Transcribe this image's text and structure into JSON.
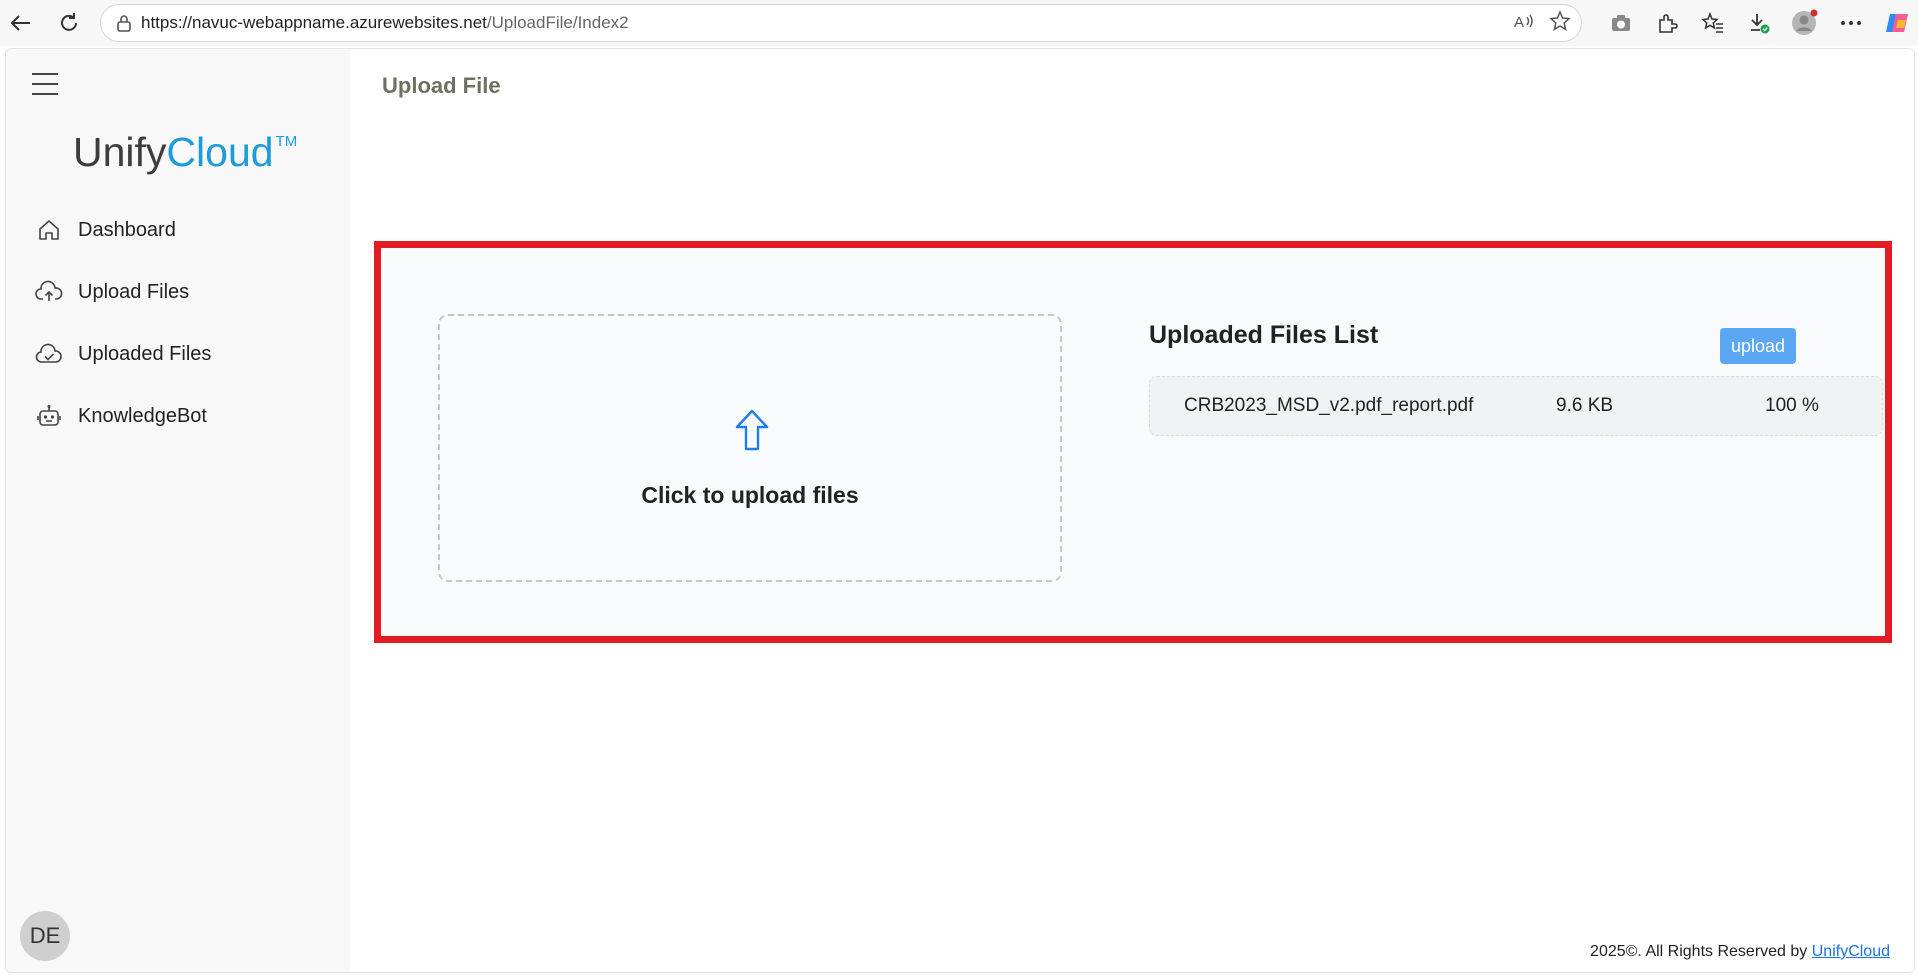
{
  "browser": {
    "url_host": "https://navuc-webappname.azurewebsites.net",
    "url_path": "/UploadFile/Index2",
    "icons": [
      "back-icon",
      "refresh-icon",
      "lock-icon",
      "read-aloud-icon",
      "favorite-star-icon",
      "screenshot-icon",
      "extensions-icon",
      "favorites-icon",
      "downloads-icon",
      "profile-icon",
      "more-icon",
      "copilot-icon"
    ]
  },
  "sidebar": {
    "brand_part1": "Unify",
    "brand_part2": "Cloud",
    "brand_tm": "TM",
    "items": [
      {
        "label": "Dashboard",
        "icon": "home-icon"
      },
      {
        "label": "Upload Files",
        "icon": "cloud-upload-icon"
      },
      {
        "label": "Uploaded Files",
        "icon": "cloud-check-icon"
      },
      {
        "label": "KnowledgeBot",
        "icon": "robot-icon"
      }
    ],
    "avatar_initials": "DE"
  },
  "main": {
    "page_title": "Upload File",
    "dropzone_text": "Click to upload files",
    "list_title": "Uploaded Files List",
    "upload_button": "upload",
    "files": [
      {
        "name": "CRB2023_MSD_v2.pdf_report.pdf",
        "size": "9.6 KB",
        "progress": "100 %"
      }
    ]
  },
  "footer": {
    "text": "2025©. All Rights Reserved by",
    "link": "UnifyCloud"
  },
  "colors": {
    "brand_blue": "#1e9cd7",
    "highlight_red": "#e31b23",
    "button_blue": "#5ba7f3"
  }
}
